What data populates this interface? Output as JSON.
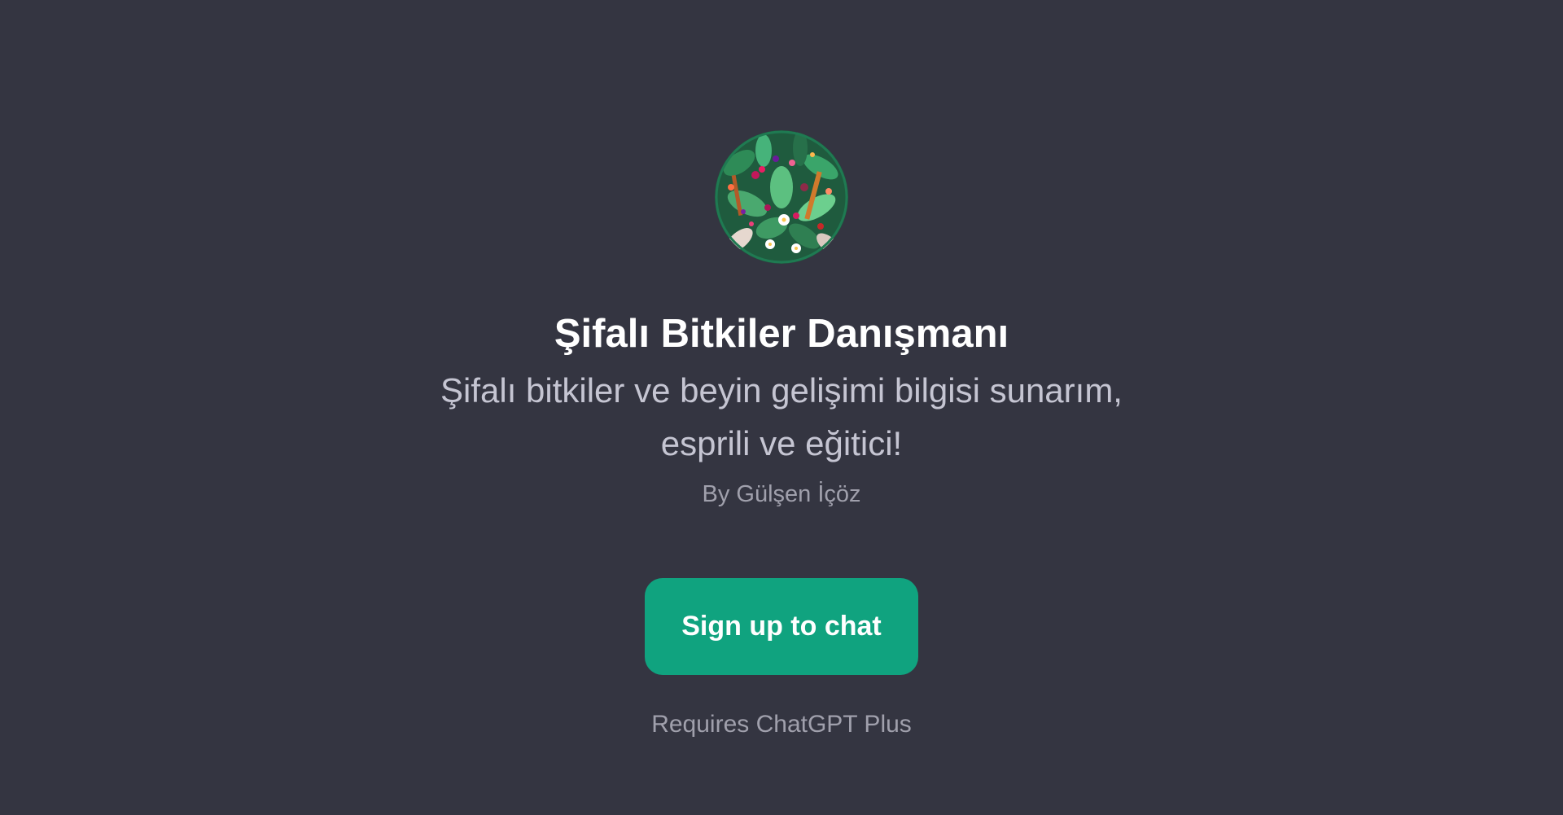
{
  "gpt": {
    "avatar_icon": "herbal-plants-avatar-icon",
    "title": "Şifalı Bitkiler Danışmanı",
    "description_line1": "Şifalı bitkiler ve beyin gelişimi bilgisi sunarım,",
    "description_line2": "esprili ve eğitici!",
    "author": "By Gülşen İçöz"
  },
  "cta": {
    "signup_label": "Sign up to chat",
    "requirement": "Requires ChatGPT Plus"
  },
  "colors": {
    "background": "#343541",
    "accent": "#10a37f",
    "title": "#ffffff",
    "subtitle": "#c5c5d2",
    "muted": "#a0a0ac"
  }
}
